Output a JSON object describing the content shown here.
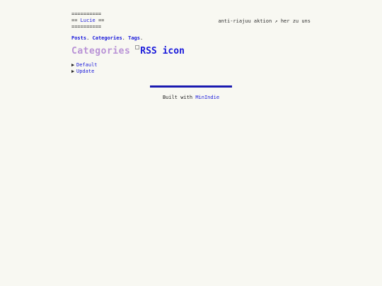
{
  "header": {
    "rule_top": "==========",
    "brand_prefix": "== ",
    "brand_name": "Lucie",
    "brand_suffix": " ==",
    "rule_bottom": "==========",
    "tagline": "anti-riajuu aktion ↗ her zu uns"
  },
  "nav": {
    "items": [
      {
        "label": "Posts",
        "sep": ". "
      },
      {
        "label": "Categories",
        "sep": ". "
      },
      {
        "label": "Tags",
        "sep": "."
      }
    ]
  },
  "page": {
    "title": "Categories",
    "rss_alt": "RSS icon"
  },
  "categories": [
    {
      "bullet": "▶",
      "label": "Default"
    },
    {
      "bullet": "▶",
      "label": "Update"
    }
  ],
  "footer": {
    "prefix": "Built with ",
    "link": "MinIndie"
  }
}
